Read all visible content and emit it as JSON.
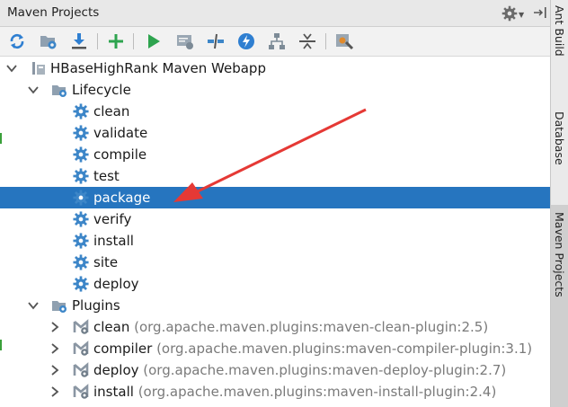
{
  "window": {
    "title": "Maven Projects"
  },
  "toolbar": {
    "buttons": [
      {
        "name": "reimport-icon"
      },
      {
        "name": "add-maven-project-icon"
      },
      {
        "name": "download-sources-icon"
      },
      {
        "name": "add-icon"
      },
      {
        "name": "run-maven-build-icon"
      },
      {
        "name": "execute-goal-icon"
      },
      {
        "name": "toggle-offline-icon"
      },
      {
        "name": "skip-tests-icon"
      },
      {
        "name": "show-dependencies-icon"
      },
      {
        "name": "collapse-all-icon"
      },
      {
        "name": "maven-settings-icon"
      }
    ]
  },
  "tree": {
    "project": "HBaseHighRank Maven Webapp",
    "lifecycle": {
      "label": "Lifecycle",
      "items": [
        "clean",
        "validate",
        "compile",
        "test",
        "package",
        "verify",
        "install",
        "site",
        "deploy"
      ],
      "selected": "package"
    },
    "plugins": {
      "label": "Plugins",
      "items": [
        {
          "name": "clean",
          "detail": "(org.apache.maven.plugins:maven-clean-plugin:2.5)"
        },
        {
          "name": "compiler",
          "detail": "(org.apache.maven.plugins:maven-compiler-plugin:3.1)"
        },
        {
          "name": "deploy",
          "detail": "(org.apache.maven.plugins:maven-deploy-plugin:2.7)"
        },
        {
          "name": "install",
          "detail": "(org.apache.maven.plugins:maven-install-plugin:2.4)"
        }
      ]
    }
  },
  "side_tabs": [
    "Ant Build",
    "Database",
    "Maven Projects"
  ],
  "colors": {
    "selection": "#2675bf",
    "gear": "#3d86c8",
    "arrow": "#e53935"
  }
}
